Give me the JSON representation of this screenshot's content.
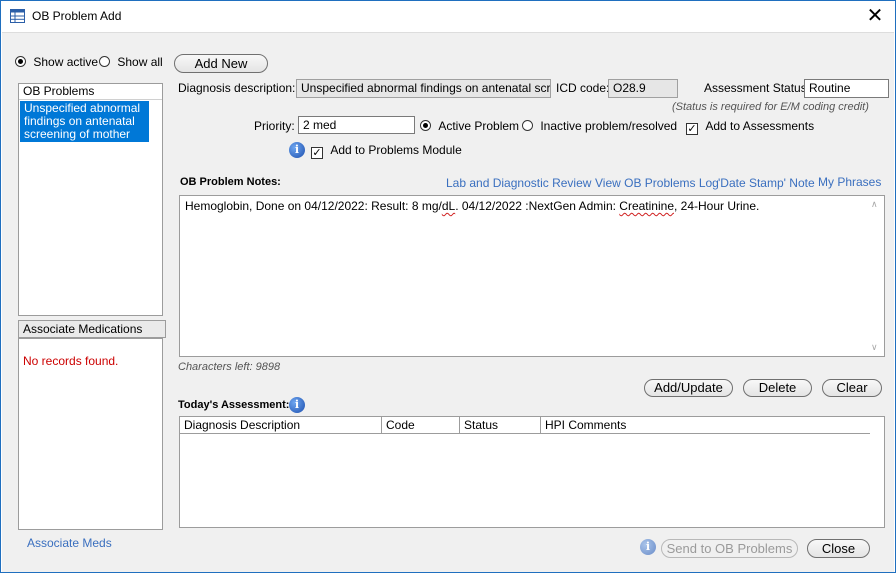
{
  "window": {
    "title": "OB Problem Add",
    "close_glyph": "✕"
  },
  "filter": {
    "show_active": "Show active",
    "show_all": "Show all",
    "selected": "Show active"
  },
  "problems": {
    "header": "OB Problems",
    "selected_item": "Unspecified abnormal findings on antenatal screening of mother"
  },
  "medications": {
    "header": "Associate Medications",
    "empty_text": "No records found."
  },
  "associate_meds_link": "Associate Meds",
  "add_new_label": "Add New",
  "diagnosis": {
    "label": "Diagnosis description:",
    "value": "Unspecified abnormal findings on antenatal screening of mother",
    "icd_label": "ICD code:",
    "icd_value": "O28.9"
  },
  "assessment_status": {
    "label": "Assessment Status:",
    "value": "Routine",
    "note": "(Status is required for E/M coding credit)"
  },
  "priority": {
    "label": "Priority:",
    "value": "2 med"
  },
  "problem_state": {
    "active": "Active Problem",
    "inactive": "Inactive problem/resolved",
    "selected": "Active Problem"
  },
  "add_to_assessments": {
    "label": "Add to Assessments",
    "checked": true
  },
  "add_to_problems": {
    "label": "Add to Problems Module",
    "checked": true
  },
  "notes": {
    "label": "OB Problem Notes:",
    "links": [
      "Lab and Diagnostic Review",
      "View OB Problems Log",
      "'Date Stamp' Note",
      "My Phrases"
    ],
    "text_before": "Hemoglobin, Done on 04/12/2022: Result: 8 mg/",
    "text_dl": "dL",
    "text_middle": ". 04/12/2022 :NextGen Admin: ",
    "text_creatinine": "Creatinine",
    "text_after": ", 24-Hour Urine.",
    "chars_left": "Characters left: 9898"
  },
  "actions": {
    "add_update": "Add/Update",
    "delete": "Delete",
    "clear": "Clear"
  },
  "assessment": {
    "label": "Today's Assessment:",
    "columns": [
      "Diagnosis Description",
      "Code",
      "Status",
      "HPI Comments"
    ]
  },
  "footer": {
    "send": "Send to OB Problems",
    "close": "Close"
  },
  "colors": {
    "accent": "#0078d7",
    "link": "#3a6fbf",
    "error": "#cc0000"
  },
  "icons": [
    "table-icon",
    "close-icon",
    "info-icon",
    "scroll-up-icon",
    "scroll-down-icon"
  ]
}
